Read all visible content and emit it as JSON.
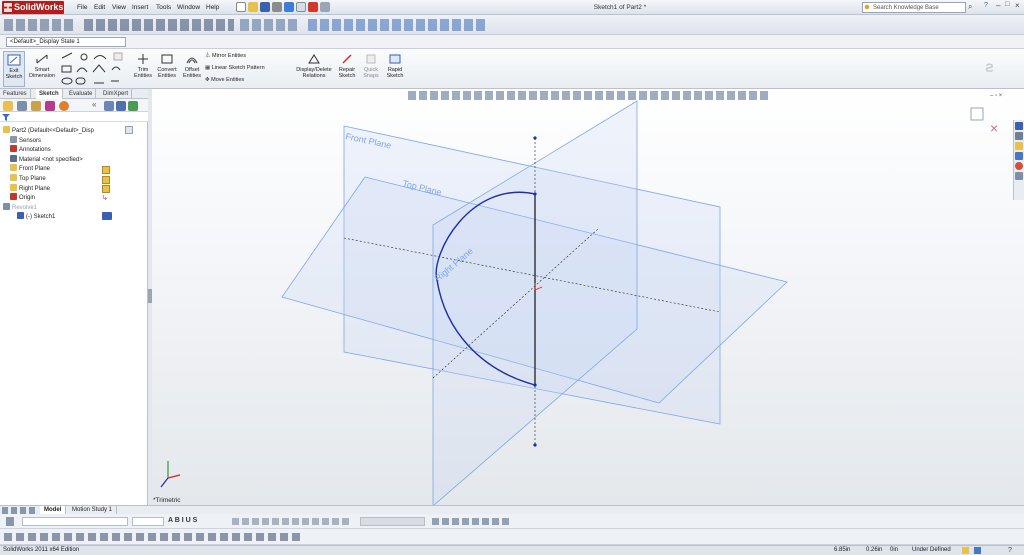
{
  "app": {
    "logo_text": "SolidWorks",
    "doc_title": "Sketch1 of Part2 *"
  },
  "menu": [
    "File",
    "Edit",
    "View",
    "Insert",
    "Tools",
    "Window",
    "Help"
  ],
  "search": {
    "placeholder": "Search Knowledge Base"
  },
  "config": {
    "selected": "<Default>_Display State 1"
  },
  "command_manager": {
    "exit_sketch": [
      "Exit",
      "Sketch"
    ],
    "smart_dimension": [
      "Smart",
      "Dimension"
    ],
    "trim_entities": [
      "Trim",
      "Entities"
    ],
    "convert_entities": [
      "Convert",
      "Entities"
    ],
    "offset_entities": [
      "Offset",
      "Entities"
    ],
    "mirror_entities": "Mirror Entities",
    "linear_sketch_pattern": "Linear Sketch Pattern",
    "move_entities": "Move Entities",
    "display_delete_relations": [
      "Display/Delete",
      "Relations"
    ],
    "repair_sketch": [
      "Repair",
      "Sketch"
    ],
    "quick_snaps": [
      "Quick",
      "Snaps"
    ],
    "rapid_sketch": [
      "Rapid",
      "Sketch"
    ]
  },
  "tabs": [
    "Features",
    "Sketch",
    "Evaluate",
    "DimXpert"
  ],
  "tree": [
    {
      "label": "Part2  (Default<<Default>_Disp",
      "indent": 0
    },
    {
      "label": "Sensors",
      "indent": 1
    },
    {
      "label": "Annotations",
      "indent": 1
    },
    {
      "label": "Material <not specified>",
      "indent": 1
    },
    {
      "label": "Front Plane",
      "indent": 1
    },
    {
      "label": "Top Plane",
      "indent": 1
    },
    {
      "label": "Right Plane",
      "indent": 1
    },
    {
      "label": "Origin",
      "indent": 1
    },
    {
      "label": "Revolve1",
      "indent": 0
    },
    {
      "label": "(-) Sketch1",
      "indent": 2
    }
  ],
  "viewport": {
    "planes": {
      "front": "Front Plane",
      "top": "Top Plane",
      "right": "Right Plane"
    },
    "view_label": "*Trimetric"
  },
  "bottom_tabs": [
    "Model",
    "Motion Study 1"
  ],
  "status": {
    "edition": "SolidWorks 2011 x64 Edition",
    "x": "6.85in",
    "y": "0.26in",
    "z": "0in",
    "state": "Under Defined"
  },
  "colors": {
    "sketch": "#1b2fa6",
    "plane": "#7fa6e8",
    "logo": "#b51d1d"
  }
}
